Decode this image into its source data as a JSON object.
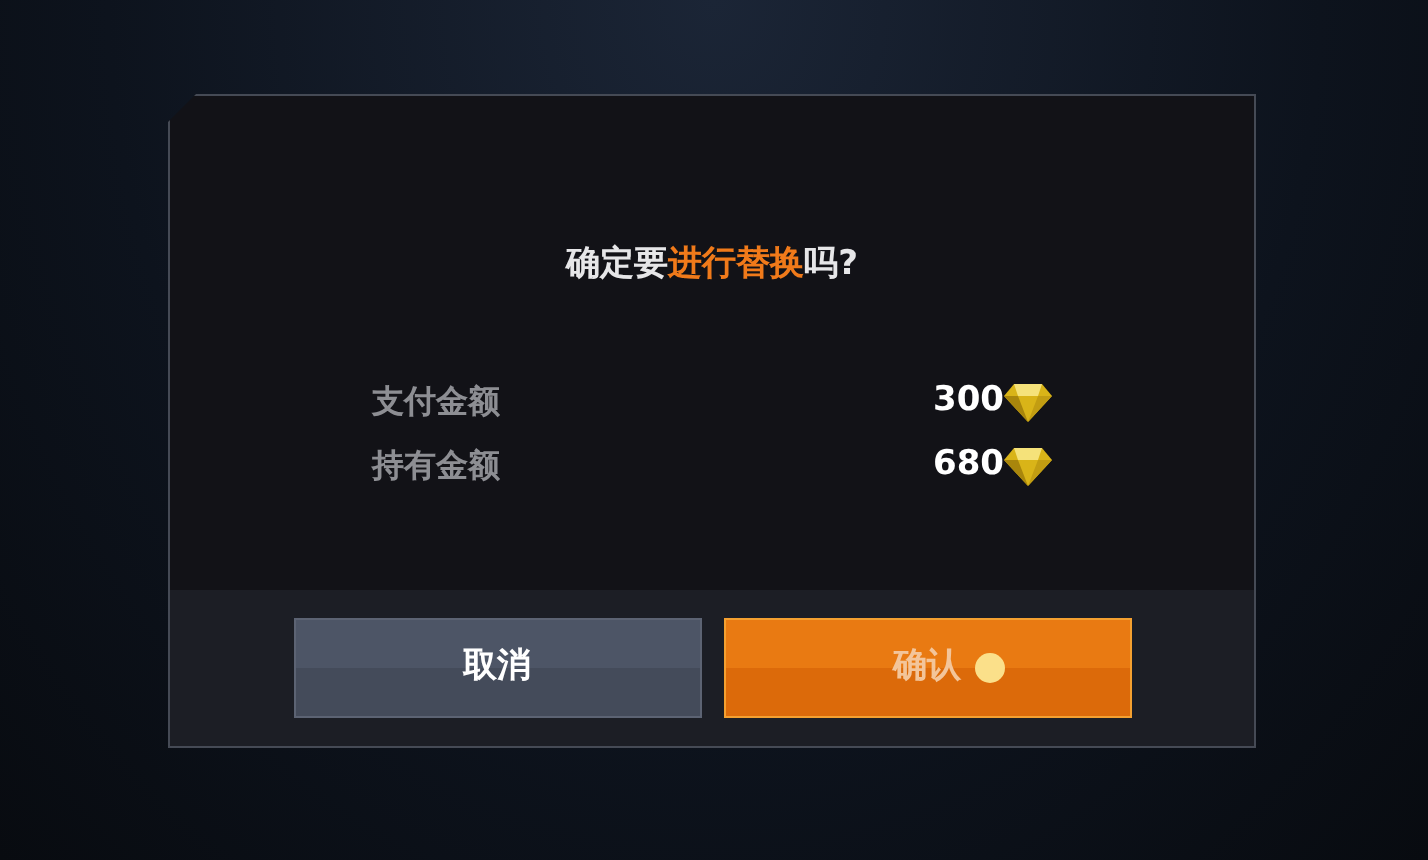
{
  "dialog": {
    "title_parts": [
      {
        "text": "确定要",
        "highlight": false
      },
      {
        "text": "进行替换",
        "highlight": true
      },
      {
        "text": "吗?",
        "highlight": false
      }
    ],
    "rows": [
      {
        "label": "支付金额",
        "amount": "300"
      },
      {
        "label": "持有金额",
        "amount": "680"
      }
    ],
    "buttons": [
      {
        "label": "取消",
        "kind": "secondary"
      },
      {
        "label": "确认",
        "kind": "primary"
      }
    ]
  }
}
